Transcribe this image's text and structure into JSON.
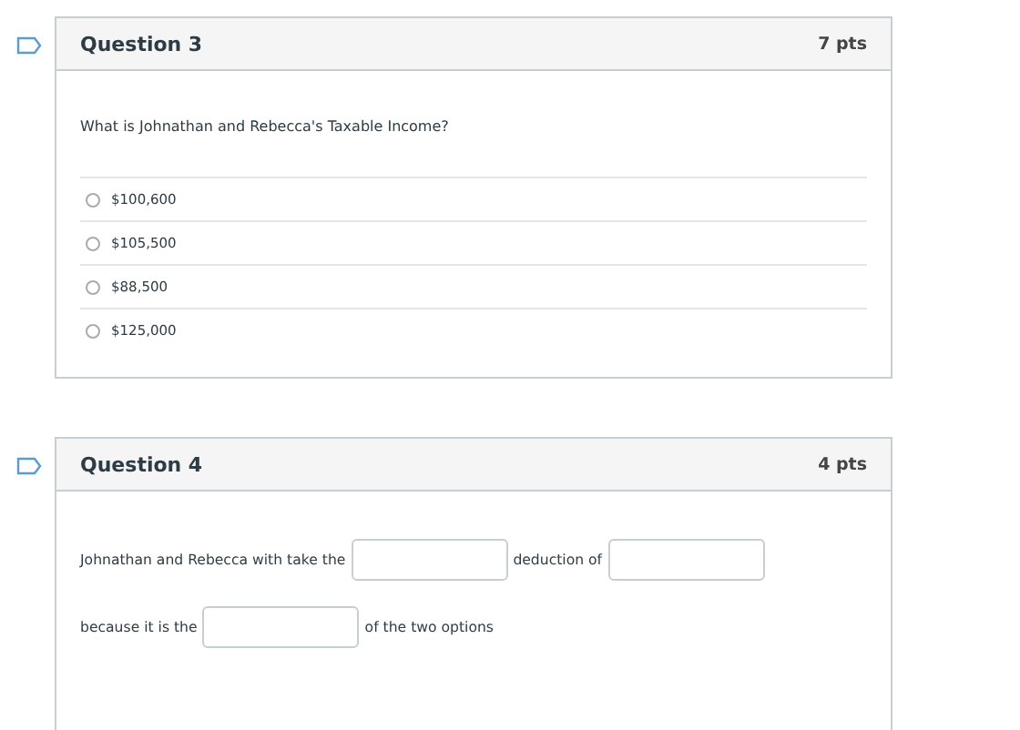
{
  "questions": [
    {
      "title": "Question 3",
      "points": "7 pts",
      "kind": "multiple_choice",
      "prompt": "What is Johnathan and Rebecca's Taxable Income?",
      "options": [
        {
          "label": "$100,600",
          "selected": false
        },
        {
          "label": "$105,500",
          "selected": false
        },
        {
          "label": "$88,500",
          "selected": false
        },
        {
          "label": "$125,000",
          "selected": false
        }
      ]
    },
    {
      "title": "Question 4",
      "points": "4 pts",
      "kind": "fill_in",
      "parts": [
        {
          "kind": "text",
          "text": "Johnathan and Rebecca with take the"
        },
        {
          "kind": "blank"
        },
        {
          "kind": "text",
          "text": "deduction of"
        },
        {
          "kind": "blank"
        },
        {
          "kind": "break"
        },
        {
          "kind": "text",
          "text": "because it is the"
        },
        {
          "kind": "blank"
        },
        {
          "kind": "text",
          "text": "of the two options"
        }
      ]
    }
  ]
}
